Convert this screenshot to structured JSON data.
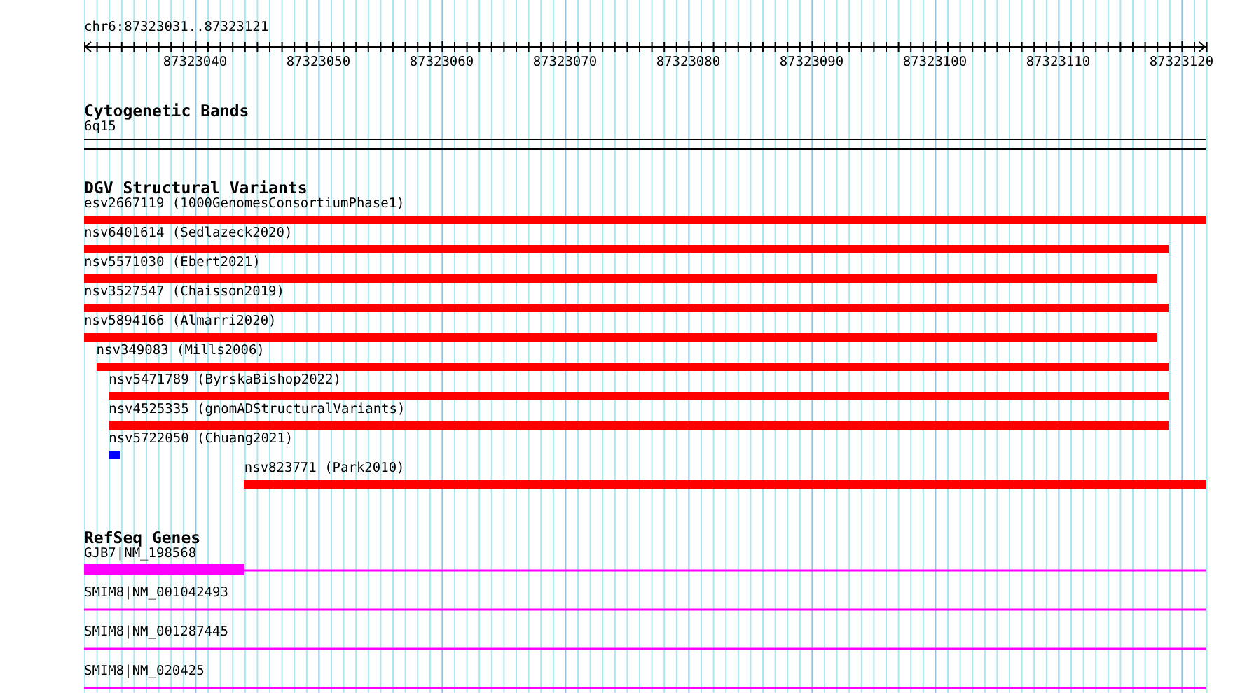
{
  "view": {
    "region": "chr6:87323031..87323121",
    "ticks": [
      "87323040",
      "87323050",
      "87323060",
      "87323070",
      "87323080",
      "87323090",
      "87323100",
      "87323110",
      "87323120"
    ]
  },
  "tracks": [
    {
      "kind": "cytoband",
      "title": "Cytogenetic Bands",
      "bands": [
        {
          "label": "6q15"
        }
      ]
    },
    {
      "kind": "variants",
      "title": "DGV Structural Variants",
      "features": [
        {
          "label": "esv2667119 (1000GenomesConsortiumPhase1)",
          "color": "#ff0000"
        },
        {
          "label": "nsv6401614 (Sedlazeck2020)",
          "color": "#ff0000"
        },
        {
          "label": "nsv5571030 (Ebert2021)",
          "color": "#ff0000"
        },
        {
          "label": "nsv3527547 (Chaisson2019)",
          "color": "#ff0000"
        },
        {
          "label": "nsv5894166 (Almarri2020)",
          "color": "#ff0000"
        },
        {
          "label": "nsv349083 (Mills2006)",
          "color": "#ff0000"
        },
        {
          "label": "nsv5471789 (ByrskaBishop2022)",
          "color": "#ff0000"
        },
        {
          "label": "nsv4525335 (gnomADStructuralVariants)",
          "color": "#ff0000"
        },
        {
          "label": "nsv5722050 (Chuang2021)",
          "color": "#0000ff"
        },
        {
          "label": "nsv823771 (Park2010)",
          "color": "#ff0000"
        }
      ]
    },
    {
      "kind": "genes",
      "title": "RefSeq Genes",
      "features": [
        {
          "label": "GJB7|NM_198568"
        },
        {
          "label": "SMIM8|NM_001042493"
        },
        {
          "label": "SMIM8|NM_001287445"
        },
        {
          "label": "SMIM8|NM_020425"
        }
      ]
    }
  ]
}
